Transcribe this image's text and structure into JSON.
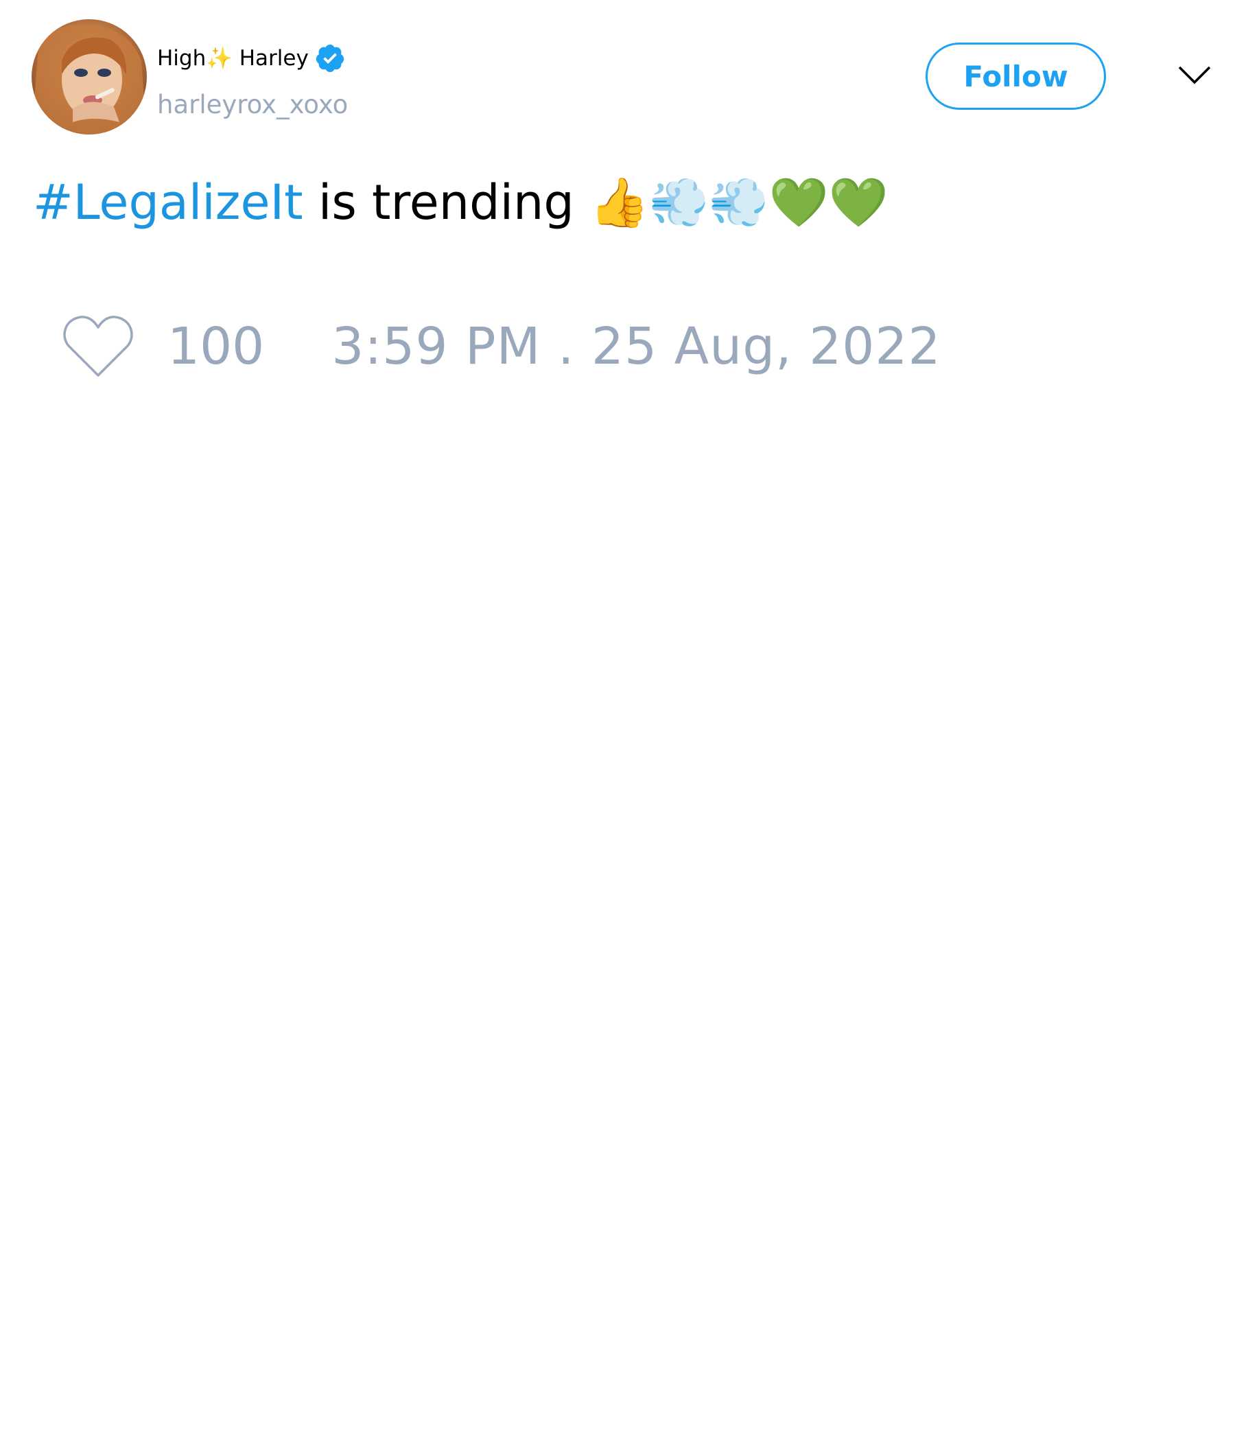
{
  "tweet": {
    "author": {
      "display_name": "High✨ Harley",
      "handle": "harleyrox_xoxo",
      "verified": true,
      "avatar_icon": "profile-photo"
    },
    "follow_label": "Follow",
    "menu_icon": "chevron-down-icon",
    "hashtag": "#LegalizeIt",
    "body_text": " is trending 👍💨💨💚💚",
    "likes": "100",
    "timestamp": "3:59 PM . 25 Aug, 2022"
  },
  "colors": {
    "accent": "#1da1f2",
    "hashtag": "#1b95e0",
    "muted": "#9aa8bc",
    "text": "#000000",
    "background": "#ffffff"
  }
}
